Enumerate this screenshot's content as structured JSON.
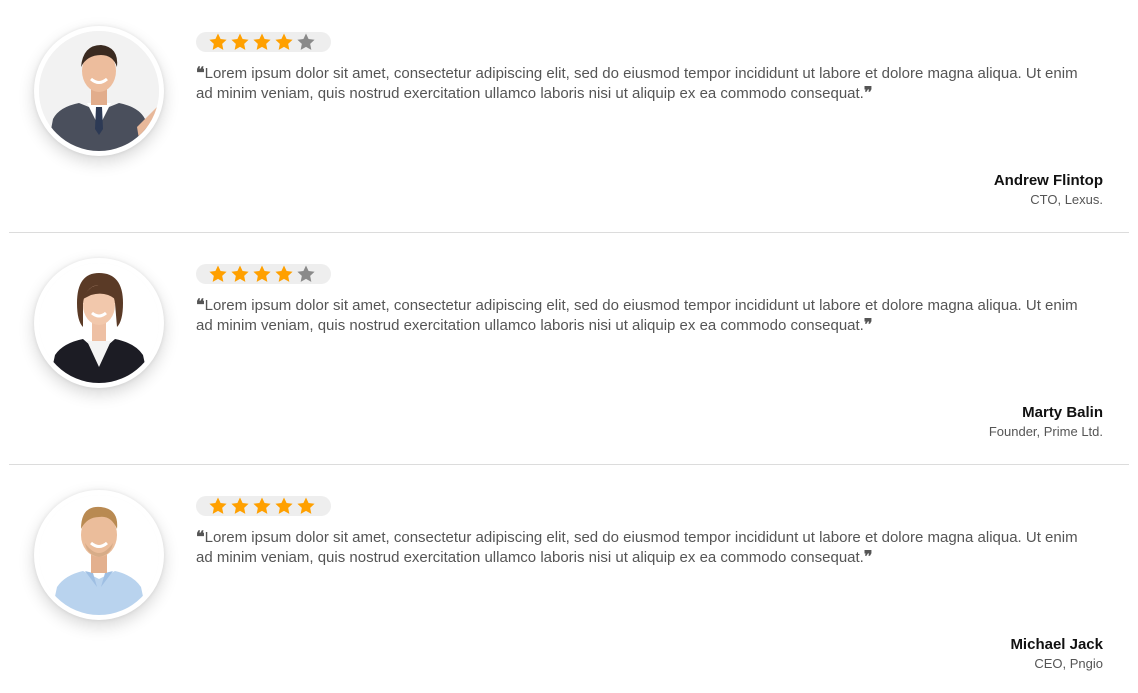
{
  "colors": {
    "star_filled": "#FFA000",
    "star_empty": "#8A8A8A",
    "rating_bg": "#EEEEEE",
    "quote_text": "#555555",
    "name_text": "#111111",
    "divider": "#DCDCDC"
  },
  "testimonials": [
    {
      "rating": 4,
      "rating_max": 5,
      "open_quote": "❝",
      "quote": "Lorem ipsum dolor sit amet, consectetur adipiscing elit, sed do eiusmod tempor incididunt ut labore et dolore magna aliqua. Ut enim ad minim veniam, quis nostrud exercitation ullamco laboris nisi ut aliquip ex ea commodo consequat.",
      "close_quote": "❞",
      "name": "Andrew Flintop",
      "role": "CTO, Lexus.",
      "avatar_icon": "man-in-suit-photo"
    },
    {
      "rating": 4,
      "rating_max": 5,
      "open_quote": "❝",
      "quote": "Lorem ipsum dolor sit amet, consectetur adipiscing elit, sed do eiusmod tempor incididunt ut labore et dolore magna aliqua. Ut enim ad minim veniam, quis nostrud exercitation ullamco laboris nisi ut aliquip ex ea commodo consequat.",
      "close_quote": "❞",
      "name": "Marty Balin",
      "role": "Founder, Prime Ltd.",
      "avatar_icon": "woman-in-blazer-photo"
    },
    {
      "rating": 5,
      "rating_max": 5,
      "open_quote": "❝",
      "quote": "Lorem ipsum dolor sit amet, consectetur adipiscing elit, sed do eiusmod tempor incididunt ut labore et dolore magna aliqua. Ut enim ad minim veniam, quis nostrud exercitation ullamco laboris nisi ut aliquip ex ea commodo consequat.",
      "close_quote": "❞",
      "name": "Michael Jack",
      "role": "CEO, Pngio",
      "avatar_icon": "man-in-blue-shirt-photo"
    }
  ]
}
